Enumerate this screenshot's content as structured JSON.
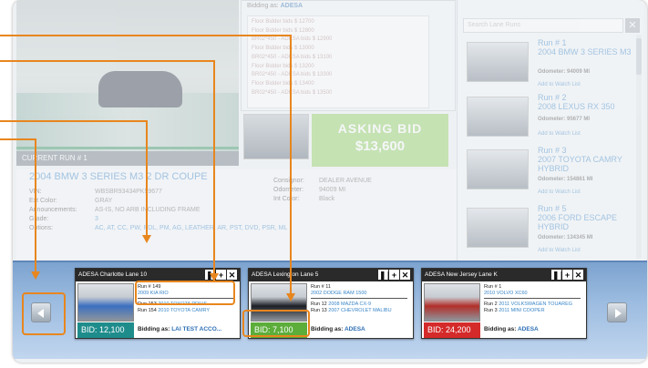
{
  "bid_log": {
    "bidding_as_label": "Bidding as:",
    "bidding_as_value": "ADESA",
    "entries": [
      "Floor Bidder bids $ 12700",
      "Floor Bidder bids $ 12800",
      "BR02*450 - ADESA bids $ 12900",
      "Floor Bidder bids $ 13000",
      "BR02*450 - ADESA bids $ 13100",
      "Floor Bidder bids $ 13200",
      "BR02*450 - ADESA bids $ 13300",
      "Floor Bidder bids $ 13400",
      "BR02*450 - ADESA bids $ 13500"
    ]
  },
  "asking": {
    "label": "ASKING BID",
    "amount": "$13,600"
  },
  "current_run": {
    "header": "CURRENT RUN # 1",
    "title": "2004 BMW 3 SERIES M3 2 DR COUPE",
    "vin_label": "VIN:",
    "vin": "WBSBR93434PK59677",
    "ext_color_label": "Ext Color:",
    "ext_color": "GRAY",
    "announcements_label": "Announcements:",
    "announcements": "AS-IS, NO ARB INCLUDING FRAME",
    "grade_label": "Grade:",
    "grade": "3",
    "options_label": "Options:",
    "options": "AC, AT, CC, PW, PDL, PM, AG, LEATHER, AR, PST, DVD, PSR, ML",
    "consignor_label": "Consignor:",
    "consignor": "DEALER AVENUE",
    "odometer_label": "Odometer:",
    "odometer": "94009 MI",
    "int_color_label": "Int Color:",
    "int_color": "Black"
  },
  "run_list": {
    "search_placeholder": "Search Lane Runs",
    "close_icon": "✕",
    "items": [
      {
        "run": "Run # 1",
        "title": "2004 BMW 3 SERIES M3",
        "odometer": "Odometer: 94009 MI",
        "watch": "Add to Watch List"
      },
      {
        "run": "Run # 2",
        "title": "2008 LEXUS RX 350",
        "odometer": "Odometer: 95677 MI",
        "watch": "Add to Watch List"
      },
      {
        "run": "Run # 3",
        "title": "2007 TOYOTA CAMRY HYBRID",
        "odometer": "Odometer: 154861 MI",
        "watch": "Add to Watch List"
      },
      {
        "run": "Run # 5",
        "title": "2006 FORD ESCAPE HYBRID",
        "odometer": "Odometer: 134345 MI",
        "watch": "Add to Watch List"
      }
    ]
  },
  "lanes": [
    {
      "header": "ADESA Charlotte Lane 10",
      "photo_color": "#3b6fc0",
      "bid": "BID: 12,100",
      "bid_color": "#1f8c8c",
      "run_a_label": "Run # 149",
      "run_a_car": "2009 KIA RIO",
      "run_b1_label": "Run 153",
      "run_b1_car": "2010 TOYOTA PRIUS",
      "run_b2_label": "Run 154",
      "run_b2_car": "2010 TOYOTA CAMRY",
      "bidding_label": "Bidding as:",
      "bidding_value": "LAI TEST ACCO..."
    },
    {
      "header": "ADESA Lexington Lane 5",
      "photo_color": "#1c1f25",
      "bid": "BID: 7,100",
      "bid_color": "#5cad3a",
      "run_a_label": "Run # 11",
      "run_a_car": "2002 DODGE RAM 1500",
      "run_b1_label": "Run 12",
      "run_b1_car": "2008 MAZDA CX-9",
      "run_b2_label": "Run 13",
      "run_b2_car": "2007 CHEVROLET MALIBU",
      "bidding_label": "Bidding as:",
      "bidding_value": "ADESA"
    },
    {
      "header": "ADESA New Jersey Lane K",
      "photo_color": "#b22f2a",
      "bid": "BID: 24,200",
      "bid_color": "#d42a2a",
      "run_a_label": "Run # 1",
      "run_a_car": "2010 VOLVO XC60",
      "run_b1_label": "Run 2",
      "run_b1_car": "2011 VOLKSWAGEN TOUAREG",
      "run_b2_label": "Run 3",
      "run_b2_car": "2011 MINI COOPER",
      "bidding_label": "Bidding as:",
      "bidding_value": "ADESA"
    }
  ],
  "card_icons": {
    "pause": "❚❚",
    "add": "+",
    "close": "✕"
  },
  "accent": "#e8861e"
}
